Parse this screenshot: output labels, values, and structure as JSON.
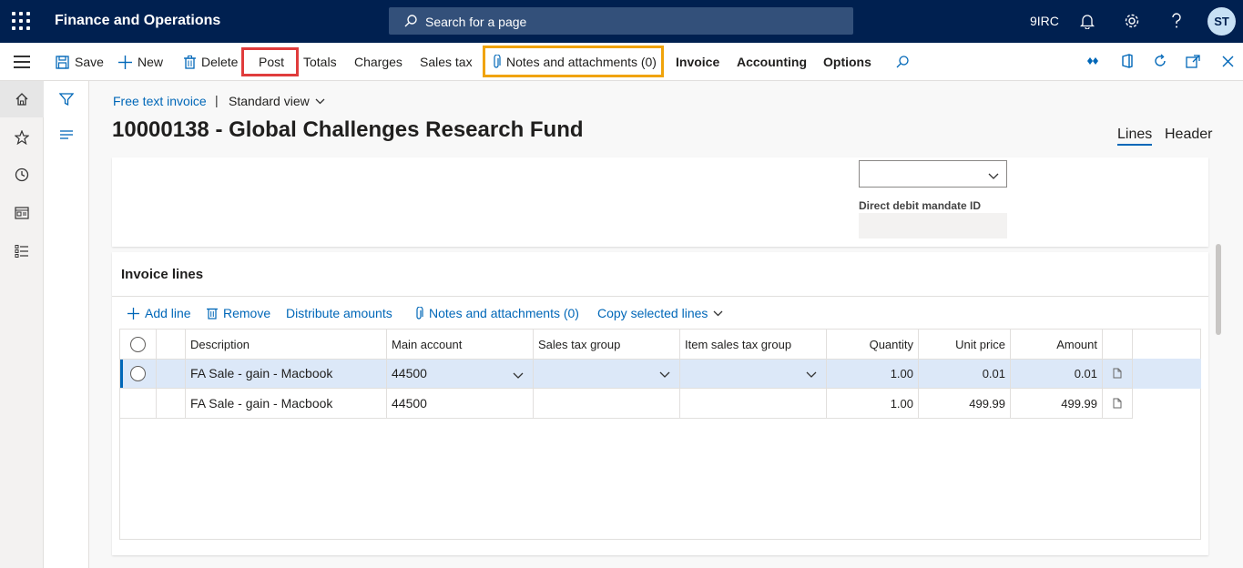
{
  "topbar": {
    "app_title": "Finance and Operations",
    "search_placeholder": "Search for a page",
    "company": "9IRC",
    "user_initials": "ST"
  },
  "commands": {
    "save": "Save",
    "new": "New",
    "delete": "Delete",
    "post": "Post",
    "totals": "Totals",
    "charges": "Charges",
    "sales_tax": "Sales tax",
    "notes": "Notes and attachments (0)",
    "invoice": "Invoice",
    "accounting": "Accounting",
    "options": "Options"
  },
  "breadcrumb": {
    "link": "Free text invoice",
    "separator": "|",
    "view": "Standard view"
  },
  "page_title": "10000138 - Global Challenges Research Fund",
  "tabs": {
    "lines": "Lines",
    "header": "Header"
  },
  "header_card": {
    "direct_debit_label": "Direct debit mandate ID"
  },
  "lines": {
    "title": "Invoice lines",
    "toolbar": {
      "add_line": "Add line",
      "remove": "Remove",
      "distribute": "Distribute amounts",
      "notes": "Notes and attachments (0)",
      "copy": "Copy selected lines"
    },
    "columns": {
      "description": "Description",
      "main_account": "Main account",
      "sales_tax_group": "Sales tax group",
      "item_sales_tax_group": "Item sales tax group",
      "quantity": "Quantity",
      "unit_price": "Unit price",
      "amount": "Amount"
    },
    "rows": [
      {
        "description": "FA Sale - gain - Macbook",
        "main_account": "44500",
        "quantity": "1.00",
        "unit_price": "0.01",
        "amount": "0.01"
      },
      {
        "description": "FA Sale - gain - Macbook",
        "main_account": "44500",
        "quantity": "1.00",
        "unit_price": "499.99",
        "amount": "499.99"
      }
    ]
  },
  "colors": {
    "topbar": "#002050",
    "accent": "#0067b8",
    "post_highlight": "#e03c3c",
    "notes_highlight": "#f0a30a"
  }
}
